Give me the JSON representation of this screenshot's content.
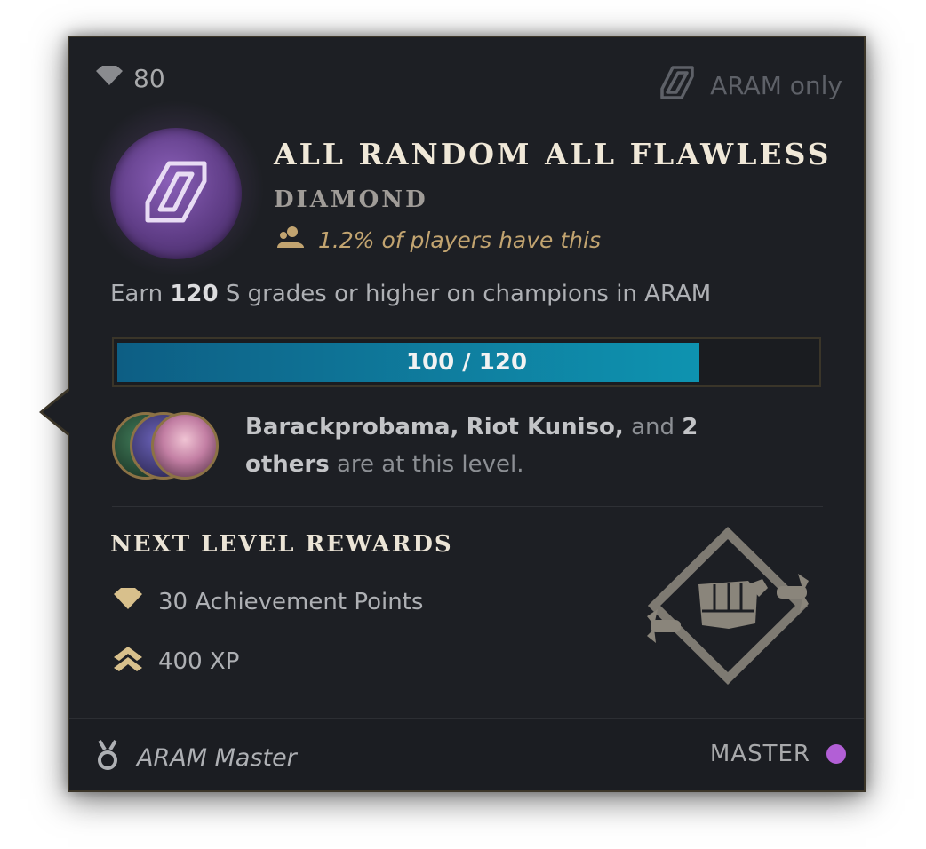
{
  "header": {
    "points": "80",
    "restriction": "ARAM only"
  },
  "achievement": {
    "title": "ALL RANDOM ALL FLAWLESS",
    "tier": "DIAMOND",
    "rarity": "1.2% of players have this",
    "description": {
      "prefix": "Earn ",
      "count": "120",
      "suffix": " S grades or higher on champions in ARAM"
    }
  },
  "progress": {
    "label": "100 / 120",
    "current": 100,
    "total": 120
  },
  "friends": {
    "name1": "Barackprobama,",
    "name2": "Riot Kuniso,",
    "and_text": "and",
    "count": "2",
    "others_word": "others",
    "suffix": "are at this level."
  },
  "rewards": {
    "title": "NEXT LEVEL REWARDS",
    "items": [
      {
        "label": "30 Achievement Points",
        "icon": "diamond-points-icon"
      },
      {
        "label": "400 XP",
        "icon": "xp-chevron-icon"
      }
    ]
  },
  "footer": {
    "category": "ARAM Master",
    "next_tier": "MASTER"
  },
  "colors": {
    "background": "#1d1f24",
    "border": "#3b3528",
    "gold": "#c2a470",
    "progress": "#0f7fa0",
    "master_dot": "#b25fd6",
    "badge": "#6b4595"
  }
}
